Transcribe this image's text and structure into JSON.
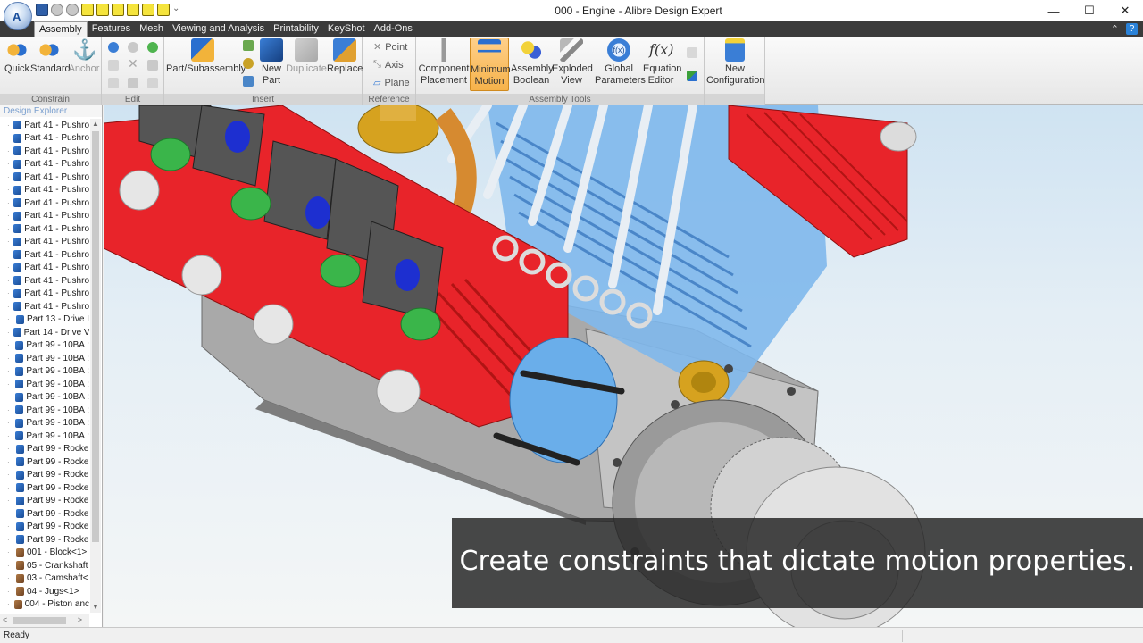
{
  "window": {
    "title": "000 - Engine - Alibre Design Expert",
    "minimize_glyph": "—",
    "maximize_glyph": "☐",
    "close_glyph": "✕"
  },
  "app_logo_glyph": "A",
  "menu": {
    "tabs": [
      "Assembly",
      "Features",
      "Mesh",
      "Viewing and Analysis",
      "Printability",
      "KeyShot",
      "Add-Ons"
    ],
    "active_tab": "Assembly",
    "right_glyph": "⌃",
    "help_glyph": "?"
  },
  "ribbon": {
    "groups": {
      "constrain": "Constrain",
      "edit": "Edit",
      "insert": "Insert",
      "reference": "Reference",
      "assembly_tools": "Assembly Tools"
    },
    "buttons": {
      "quick": "Quick",
      "standard": "Standard",
      "anchor": "Anchor",
      "part_subassembly": "Part/Subassembly",
      "new_part_1": "New",
      "new_part_2": "Part",
      "duplicate": "Duplicate",
      "replace": "Replace",
      "point": "Point",
      "axis": "Axis",
      "plane": "Plane",
      "component_placement_1": "Component",
      "component_placement_2": "Placement",
      "minimum_motion_1": "Minimum",
      "minimum_motion_2": "Motion",
      "assembly_boolean_1": "Assembly",
      "assembly_boolean_2": "Boolean",
      "exploded_view_1": "Exploded",
      "exploded_view_2": "View",
      "global_parameters_1": "Global",
      "global_parameters_2": "Parameters",
      "equation_editor_1": "Equation",
      "equation_editor_2": "Editor",
      "equation_icon_text": "f(x)",
      "global_icon_text": "f(x)",
      "new_configuration_1": "New",
      "new_configuration_2": "Configuration"
    }
  },
  "explorer": {
    "title": "Design Explorer",
    "items": [
      {
        "label": "Part 41 - Pushro",
        "type": "part"
      },
      {
        "label": "Part 41 - Pushro",
        "type": "part"
      },
      {
        "label": "Part 41 - Pushro",
        "type": "part"
      },
      {
        "label": "Part 41 - Pushro",
        "type": "part"
      },
      {
        "label": "Part 41 - Pushro",
        "type": "part"
      },
      {
        "label": "Part 41 - Pushro",
        "type": "part"
      },
      {
        "label": "Part 41 - Pushro",
        "type": "part"
      },
      {
        "label": "Part 41 - Pushro",
        "type": "part"
      },
      {
        "label": "Part 41 - Pushro",
        "type": "part"
      },
      {
        "label": "Part 41 - Pushro",
        "type": "part"
      },
      {
        "label": "Part 41 - Pushro",
        "type": "part"
      },
      {
        "label": "Part 41 - Pushro",
        "type": "part"
      },
      {
        "label": "Part 41 - Pushro",
        "type": "part"
      },
      {
        "label": "Part 41 - Pushro",
        "type": "part"
      },
      {
        "label": "Part 41 - Pushro",
        "type": "part"
      },
      {
        "label": "Part 13 - Drive I",
        "type": "part"
      },
      {
        "label": "Part 14 - Drive V",
        "type": "part"
      },
      {
        "label": "Part 99 - 10BA :",
        "type": "part"
      },
      {
        "label": "Part 99 - 10BA :",
        "type": "part"
      },
      {
        "label": "Part 99 - 10BA :",
        "type": "part"
      },
      {
        "label": "Part 99 - 10BA :",
        "type": "part"
      },
      {
        "label": "Part 99 - 10BA :",
        "type": "part"
      },
      {
        "label": "Part 99 - 10BA :",
        "type": "part"
      },
      {
        "label": "Part 99 - 10BA :",
        "type": "part"
      },
      {
        "label": "Part 99 - 10BA :",
        "type": "part"
      },
      {
        "label": "Part 99 - Rocke",
        "type": "part"
      },
      {
        "label": "Part 99 - Rocke",
        "type": "part"
      },
      {
        "label": "Part 99 - Rocke",
        "type": "part"
      },
      {
        "label": "Part 99 - Rocke",
        "type": "part"
      },
      {
        "label": "Part 99 - Rocke",
        "type": "part"
      },
      {
        "label": "Part 99 - Rocke",
        "type": "part"
      },
      {
        "label": "Part 99 - Rocke",
        "type": "part"
      },
      {
        "label": "Part 99 - Rocke",
        "type": "part"
      },
      {
        "label": "001 - Block<1>",
        "type": "asm"
      },
      {
        "label": "05 - Crankshaft",
        "type": "asm"
      },
      {
        "label": "03 - Camshaft<",
        "type": "asm"
      },
      {
        "label": "04 - Jugs<1>",
        "type": "asm"
      },
      {
        "label": "004 - Piston anc",
        "type": "asm"
      }
    ],
    "scroll_up": "▲",
    "scroll_down": "▼",
    "scroll_left": "<",
    "scroll_right": ">"
  },
  "viewport": {
    "caption": "Create constraints that dictate motion properties."
  },
  "status": {
    "text": "Ready"
  },
  "colors": {
    "red": "#e8242a",
    "blue_cyl": "#5ea8f0",
    "gray_block": "#b8b8b8",
    "brass": "#d6a21f",
    "green_spring": "#3ab54a",
    "dark_blue": "#1d2fd0"
  }
}
